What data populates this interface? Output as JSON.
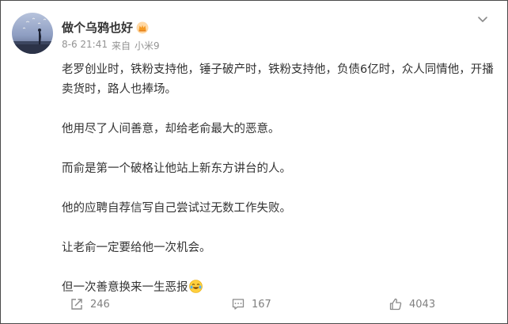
{
  "user": {
    "name": "做个乌鸦也好",
    "badge_icon": "crown-icon"
  },
  "post_meta": {
    "date": "8-6 21:41",
    "source_prefix": "来自",
    "device": "小米9"
  },
  "more_icon": "chevron-down-icon",
  "content": {
    "paragraphs": [
      "老罗创业时，铁粉支持他，锤子破产时，铁粉支持他，负债6亿时，众人同情他，开播卖货时，路人也捧场。",
      "他用尽了人间善意，却给老俞最大的恶意。",
      "而俞是第一个破格让他站上新东方讲台的人。",
      "他的应聘自荐信写自己尝试过无数工作失败。",
      "让老俞一定要给他一次机会。",
      "但一次善意换来一生恶报"
    ],
    "trailing_emoji": "crying-laughing-emoji"
  },
  "actions": {
    "repost": {
      "icon": "share-icon",
      "count": "246"
    },
    "comment": {
      "icon": "comment-icon",
      "count": "167"
    },
    "like": {
      "icon": "thumbs-up-icon",
      "count": "4043"
    }
  },
  "colors": {
    "text_primary": "#333333",
    "text_meta": "#939393",
    "action_gray": "#808080",
    "border": "#4a4a4a"
  }
}
